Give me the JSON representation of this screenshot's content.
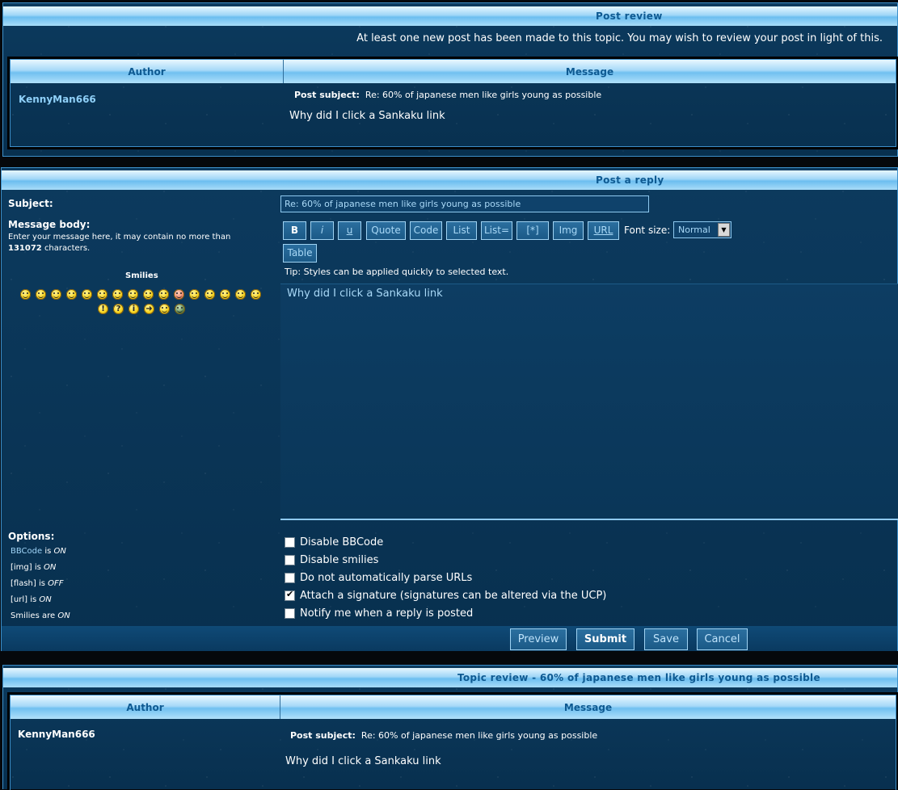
{
  "post_review": {
    "title": "Post review",
    "notice": "At least one new post has been made to this topic. You may wish to review your post in light of this.",
    "col_author": "Author",
    "col_message": "Message",
    "author": "KennyMan666",
    "subject_label": "Post subject:",
    "subject": "Re: 60% of japanese men like girls young as possible",
    "body": "Why did I click a Sankaku link"
  },
  "post_reply": {
    "title": "Post a reply",
    "subject_label": "Subject:",
    "subject_value": "Re: 60% of japanese men like girls young as possible",
    "body_label": "Message body:",
    "body_hint_1": "Enter your message here, it may contain no more than",
    "body_hint_limit": "131072",
    "body_hint_2": "characters.",
    "smilies_label": "Smilies",
    "toolbar": {
      "bold": "B",
      "italic": "i",
      "underline": "u",
      "quote": "Quote",
      "code": "Code",
      "list": "List",
      "list_eq": "List=",
      "list_item": "[*]",
      "img": "Img",
      "url": "URL",
      "table": "Table",
      "font_size_label": "Font size:",
      "font_size_value": "Normal"
    },
    "tip": "Tip: Styles can be applied quickly to selected text.",
    "message_text": "Why did I click a Sankaku link",
    "options_label": "Options:",
    "status": {
      "bbcode_link": "BBCode",
      "bbcode_is": "is",
      "bbcode_state": "ON",
      "img_label": "[img] is",
      "img_state": "ON",
      "flash_label": "[flash] is",
      "flash_state": "OFF",
      "url_label": "[url] is",
      "url_state": "ON",
      "smilies_label": "Smilies are",
      "smilies_state": "ON"
    },
    "options": [
      {
        "label": "Disable BBCode",
        "checked": false
      },
      {
        "label": "Disable smilies",
        "checked": false
      },
      {
        "label": "Do not automatically parse URLs",
        "checked": false
      },
      {
        "label": "Attach a signature (signatures can be altered via the UCP)",
        "checked": true
      },
      {
        "label": "Notify me when a reply is posted",
        "checked": false
      }
    ],
    "buttons": {
      "preview": "Preview",
      "submit": "Submit",
      "save": "Save",
      "cancel": "Cancel"
    }
  },
  "topic_review": {
    "title": "Topic review - 60% of japanese men like girls young as possible",
    "col_author": "Author",
    "col_message": "Message",
    "author": "KennyMan666",
    "subject_label": "Post subject:",
    "subject": "Re: 60% of japanese men like girls young as possible",
    "body": "Why did I click a Sankaku link"
  }
}
